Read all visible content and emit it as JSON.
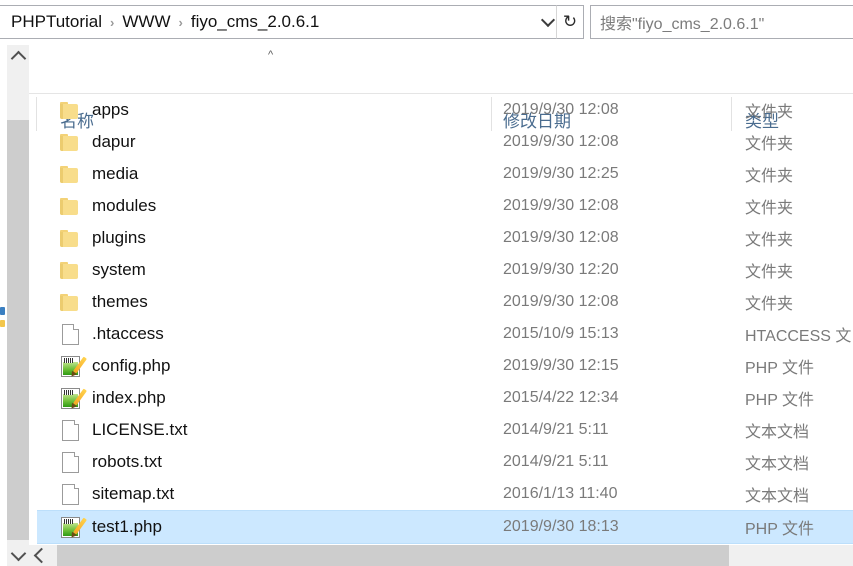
{
  "window": {
    "title": "fiyo_cms_2.0.6.1"
  },
  "addressbar": {
    "breadcrumbs": [
      "PHPTutorial",
      "WWW",
      "fiyo_cms_2.0.6.1"
    ],
    "separator": "›",
    "dropdown_icon": "chevron-down-icon",
    "refresh_icon": "refresh-icon",
    "refresh_glyph": "↻"
  },
  "search": {
    "placeholder": "搜索\"fiyo_cms_2.0.6.1\"",
    "value": ""
  },
  "columns": {
    "name": "名称",
    "date_modified": "修改日期",
    "type": "类型",
    "sort_indicator": "^",
    "sort_column": "名称",
    "sort_direction": "ascending"
  },
  "files": [
    {
      "name": "apps",
      "date": "2019/9/30 12:08",
      "type": "文件夹",
      "icon": "folder-icon",
      "selected": false
    },
    {
      "name": "dapur",
      "date": "2019/9/30 12:08",
      "type": "文件夹",
      "icon": "folder-icon",
      "selected": false
    },
    {
      "name": "media",
      "date": "2019/9/30 12:25",
      "type": "文件夹",
      "icon": "folder-icon",
      "selected": false
    },
    {
      "name": "modules",
      "date": "2019/9/30 12:08",
      "type": "文件夹",
      "icon": "folder-icon",
      "selected": false
    },
    {
      "name": "plugins",
      "date": "2019/9/30 12:08",
      "type": "文件夹",
      "icon": "folder-icon",
      "selected": false
    },
    {
      "name": "system",
      "date": "2019/9/30 12:20",
      "type": "文件夹",
      "icon": "folder-icon",
      "selected": false
    },
    {
      "name": "themes",
      "date": "2019/9/30 12:08",
      "type": "文件夹",
      "icon": "folder-icon",
      "selected": false
    },
    {
      "name": ".htaccess",
      "date": "2015/10/9 15:13",
      "type": "HTACCESS 文",
      "icon": "blank-document-icon",
      "selected": false
    },
    {
      "name": "config.php",
      "date": "2019/9/30 12:15",
      "type": "PHP 文件",
      "icon": "php-file-icon",
      "selected": false
    },
    {
      "name": "index.php",
      "date": "2015/4/22 12:34",
      "type": "PHP 文件",
      "icon": "php-file-icon",
      "selected": false
    },
    {
      "name": "LICENSE.txt",
      "date": "2014/9/21 5:11",
      "type": "文本文档",
      "icon": "text-file-icon",
      "selected": false
    },
    {
      "name": "robots.txt",
      "date": "2014/9/21 5:11",
      "type": "文本文档",
      "icon": "text-file-icon",
      "selected": false
    },
    {
      "name": "sitemap.txt",
      "date": "2016/1/13 11:40",
      "type": "文本文档",
      "icon": "text-file-icon",
      "selected": false
    },
    {
      "name": "test1.php",
      "date": "2019/9/30 18:13",
      "type": "PHP 文件",
      "icon": "php-file-icon",
      "selected": true
    }
  ],
  "colors": {
    "selection": "#cce8ff",
    "column_header_text": "#4a6c8f",
    "secondary_text": "#7a7a7a",
    "scrollbar_thumb": "#cdcdcd",
    "folder": "#f8dd8b"
  },
  "scrollbars": {
    "vertical_up": "scroll-up-icon",
    "vertical_down": "scroll-down-icon",
    "horizontal_left": "scroll-left-icon"
  }
}
